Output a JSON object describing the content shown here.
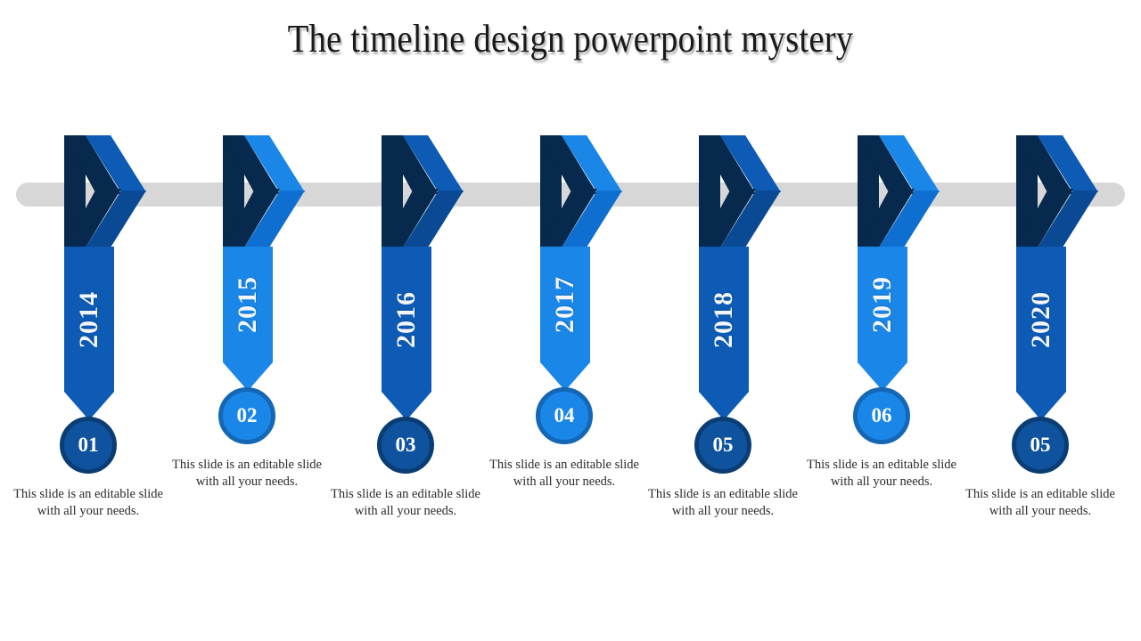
{
  "slide": {
    "title": "The timeline design powerpoint mystery",
    "background_color": "#ffffff",
    "spine_color": "#d7d7d7"
  },
  "palette": {
    "dark_blue": "#0d5bb5",
    "dark_blue_shade": "#0a4a94",
    "navy_fold": "#06294d",
    "bright_blue": "#1a87e8",
    "bright_blue_shade": "#0f6fd0",
    "circle_dark_fill": "#0f539f",
    "circle_dark_ring": "#0a3d73",
    "circle_bright_fill": "#1a87e8",
    "circle_bright_ring": "#1467b5",
    "number_color": "#ffffff",
    "year_color": "#f2f6fa",
    "caption_color": "#2b2b2b"
  },
  "caption_text": "This slide is an editable slide with all your needs.",
  "timeline": {
    "items": [
      {
        "year": "2014",
        "number": "01",
        "tone": "dark",
        "caption": "This slide is an editable slide with all your needs."
      },
      {
        "year": "2015",
        "number": "02",
        "tone": "bright",
        "caption": "This slide is an editable slide with all your needs."
      },
      {
        "year": "2016",
        "number": "03",
        "tone": "dark",
        "caption": "This slide is an editable slide with all your needs."
      },
      {
        "year": "2017",
        "number": "04",
        "tone": "bright",
        "caption": "This slide is an editable slide with all your needs."
      },
      {
        "year": "2018",
        "number": "05",
        "tone": "dark",
        "caption": "This slide is an editable slide with all your needs."
      },
      {
        "year": "2019",
        "number": "06",
        "tone": "bright",
        "caption": "This slide is an editable slide with all your needs."
      },
      {
        "year": "2020",
        "number": "05",
        "tone": "dark",
        "caption": "This slide is an editable slide with all your needs."
      }
    ]
  }
}
